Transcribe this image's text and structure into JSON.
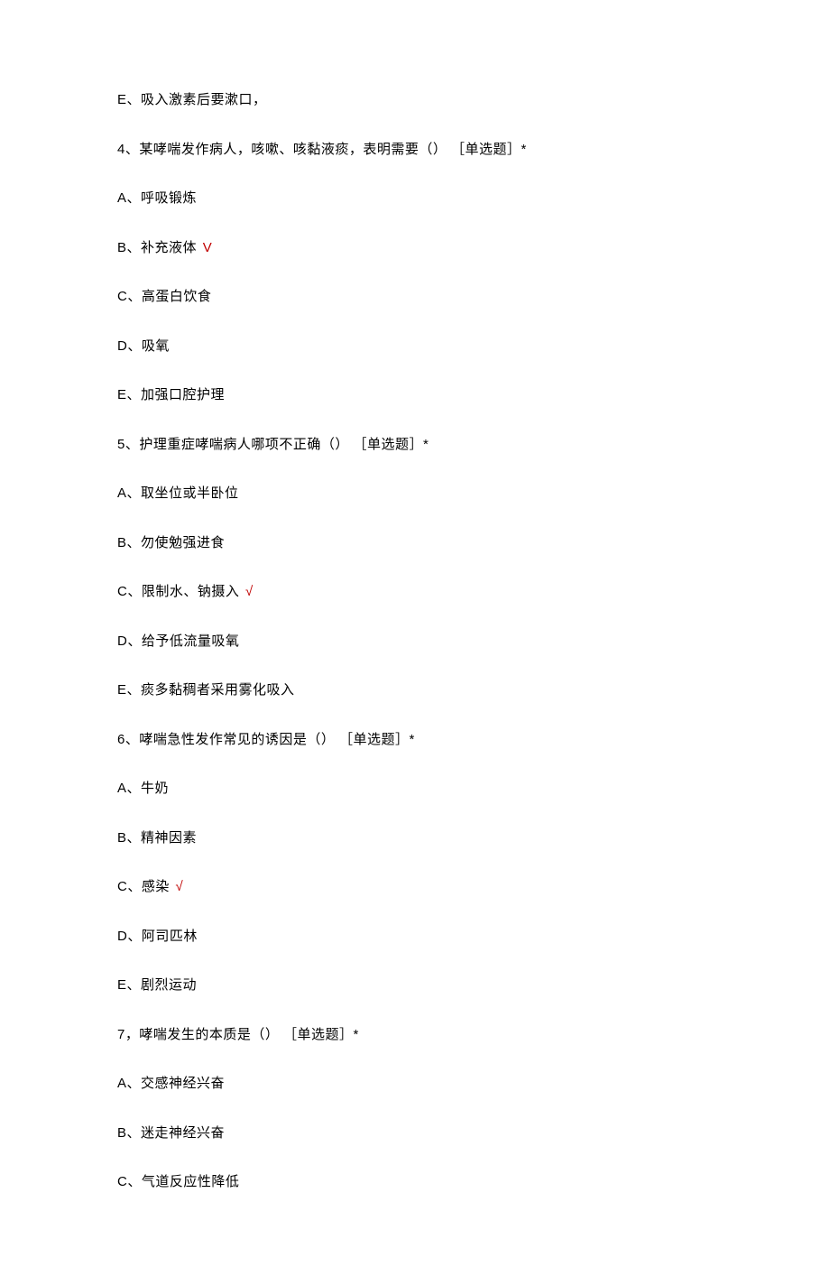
{
  "orphan_option": "E、吸入激素后要漱口，",
  "questions": [
    {
      "number": "4、",
      "text": "某哮喘发作病人，咳嗽、咳黏液痰，表明需要（）",
      "tag": "［单选题］*",
      "options": [
        {
          "label": "A、呼吸锻炼",
          "correct": false
        },
        {
          "label": "B、补充液体",
          "correct": true,
          "mark": "V"
        },
        {
          "label": "C、高蛋白饮食",
          "correct": false
        },
        {
          "label": "D、吸氧",
          "correct": false
        },
        {
          "label": "E、加强口腔护理",
          "correct": false
        }
      ]
    },
    {
      "number": "5、",
      "text": "护理重症哮喘病人哪项不正确（）",
      "tag": "［单选题］*",
      "options": [
        {
          "label": "A、取坐位或半卧位",
          "correct": false
        },
        {
          "label": "B、勿使勉强进食",
          "correct": false
        },
        {
          "label": "C、限制水、钠摄入",
          "correct": true,
          "mark": "√"
        },
        {
          "label": "D、给予低流量吸氧",
          "correct": false
        },
        {
          "label": "E、痰多黏稠者采用雾化吸入",
          "correct": false
        }
      ]
    },
    {
      "number": "6、",
      "text": "哮喘急性发作常见的诱因是（）",
      "tag": "［单选题］*",
      "options": [
        {
          "label": "A、牛奶",
          "correct": false
        },
        {
          "label": "B、精神因素",
          "correct": false
        },
        {
          "label": "C、感染",
          "correct": true,
          "mark": "√"
        },
        {
          "label": "D、阿司匹林",
          "correct": false
        },
        {
          "label": "E、剧烈运动",
          "correct": false
        }
      ]
    },
    {
      "number": "7，",
      "text": "哮喘发生的本质是（）",
      "tag": "［单选题］*",
      "options": [
        {
          "label": "A、交感神经兴奋",
          "correct": false
        },
        {
          "label": "B、迷走神经兴奋",
          "correct": false
        },
        {
          "label": "C、气道反应性降低",
          "correct": false
        }
      ]
    }
  ]
}
